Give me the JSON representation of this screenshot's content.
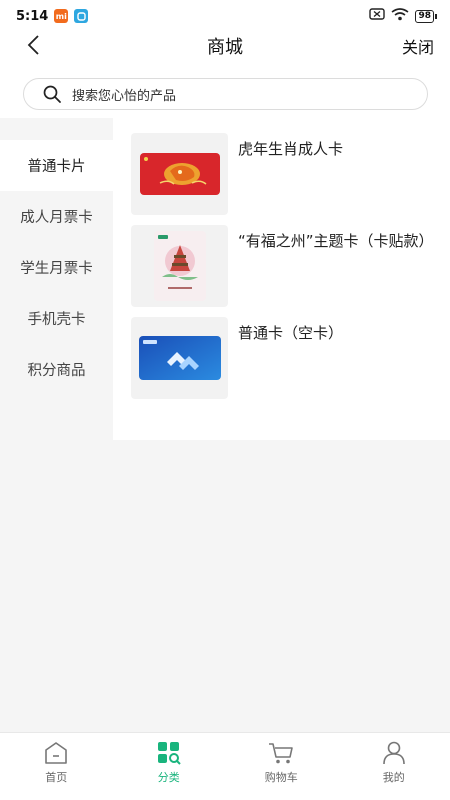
{
  "status_bar": {
    "time": "5:14",
    "badge_mi": "mi",
    "battery": "98"
  },
  "header": {
    "title": "商城",
    "close_label": "关闭"
  },
  "search": {
    "placeholder": "搜索您心怡的产品"
  },
  "sidebar": {
    "items": [
      {
        "label": "普通卡片",
        "active": true
      },
      {
        "label": "成人月票卡",
        "active": false
      },
      {
        "label": "学生月票卡",
        "active": false
      },
      {
        "label": "手机壳卡",
        "active": false
      },
      {
        "label": "积分商品",
        "active": false
      }
    ]
  },
  "products": [
    {
      "name": "虎年生肖成人卡"
    },
    {
      "name": "“有福之州”主题卡（卡贴款）"
    },
    {
      "name": "普通卡（空卡）"
    }
  ],
  "tabbar": {
    "items": [
      {
        "label": "首页",
        "icon": "home-icon"
      },
      {
        "label": "分类",
        "icon": "category-icon"
      },
      {
        "label": "购物车",
        "icon": "cart-icon"
      },
      {
        "label": "我的",
        "icon": "profile-icon"
      }
    ]
  },
  "colors": {
    "accent": "#19b47d",
    "background": "#f5f5f5"
  }
}
